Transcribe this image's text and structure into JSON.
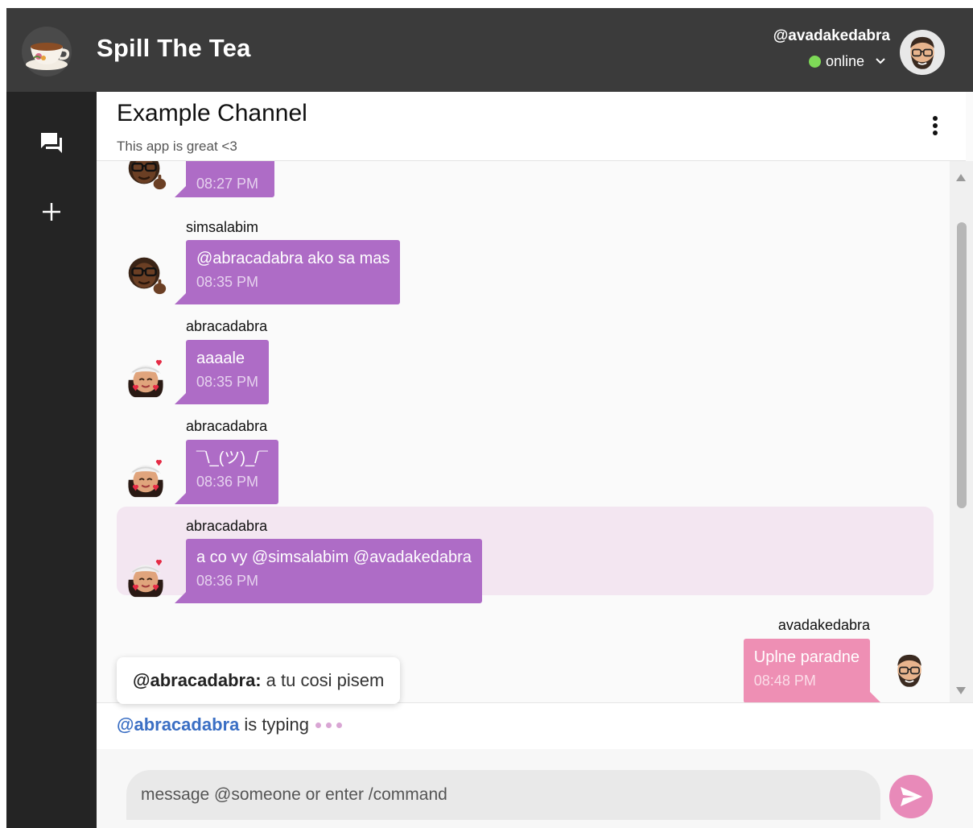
{
  "header": {
    "app_name": "Spill The Tea",
    "current_user": "@avadakedabra",
    "status": "online"
  },
  "channel": {
    "title": "Example Channel",
    "subtitle": "This app is great <3"
  },
  "messages": [
    {
      "author": "",
      "text": "",
      "time": "08:27 PM",
      "avatar": "simsalabim-avatar"
    },
    {
      "author": "simsalabim",
      "text": "@abracadabra ako sa mas",
      "time": "08:35 PM",
      "avatar": "simsalabim-avatar"
    },
    {
      "author": "abracadabra",
      "text": "aaaale",
      "time": "08:35 PM",
      "avatar": "abracadabra-avatar"
    },
    {
      "author": "abracadabra",
      "text": "¯\\_(ツ)_/¯",
      "time": "08:36 PM",
      "avatar": "abracadabra-avatar"
    },
    {
      "author": "abracadabra",
      "text": "a co vy @simsalabim @avadakedabra",
      "time": "08:36 PM",
      "avatar": "abracadabra-avatar",
      "highlighted": true
    },
    {
      "author": "avadakedabra",
      "text": "Uplne paradne",
      "time": "08:48 PM",
      "avatar": "avadakedabra-avatar",
      "own": true
    }
  ],
  "reply_preview": {
    "mention": "@abracadabra:",
    "text": "a tu cosi pisem"
  },
  "typing": {
    "user": "@abracadabra",
    "text": "is typing"
  },
  "composer": {
    "placeholder": "message @someone or enter /command"
  },
  "colors": {
    "header_bg": "#3b3b3b",
    "sidebar_bg": "#242424",
    "bubble_other": "#ae6cc6",
    "bubble_own": "#ee8fb4",
    "highlight_bg": "#f3e6f1",
    "status_online": "#7ed957",
    "mention_blue": "#3b6fc4",
    "send_button": "#e88ab9"
  },
  "icons": {
    "logo": "teacup-logo-icon",
    "sidebar_chats": "chat-bubbles-icon",
    "sidebar_add": "plus-icon",
    "menu": "kebab-menu-icon",
    "send": "send-icon",
    "status_toggle": "chevron-down-icon"
  }
}
